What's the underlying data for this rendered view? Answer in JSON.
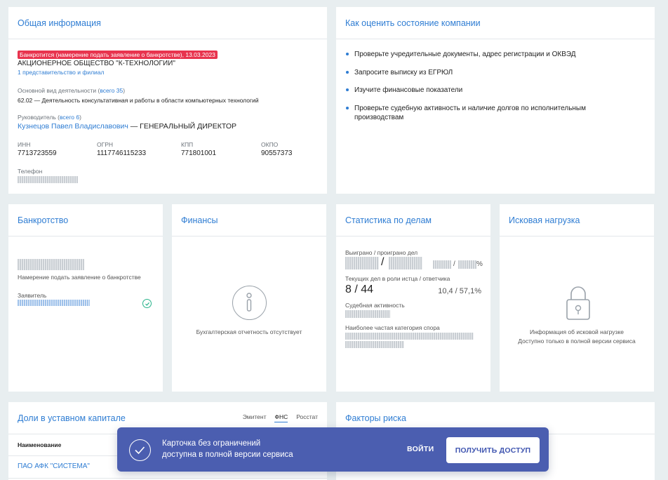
{
  "general": {
    "title": "Общая информация",
    "bankrupt_badge": "Банкротится (намерение подать заявление о банкротстве), 13.03.2023",
    "company_name": "АКЦИОНЕРНОЕ ОБЩЕСТВО \"К-ТЕХНОЛОГИИ\"",
    "branches_link": "1 представительство и филиал",
    "activity_label": "Основной вид деятельности (",
    "activity_count": "всего 35",
    "activity_close": ")",
    "activity_value": "62.02 — Деятельность консультативная и работы в области компьютерных технологий",
    "director_label": "Руководитель (",
    "director_count": "всего 6",
    "director_close": ")",
    "director_name": "Кузнецов Павел Владиславович",
    "director_role": " — ГЕНЕРАЛЬНЫЙ ДИРЕКТОР",
    "inn_label": "ИНН",
    "inn": "7713723559",
    "ogrn_label": "ОГРН",
    "ogrn": "1117746115233",
    "kpp_label": "КПП",
    "kpp": "771801001",
    "okpo_label": "ОКПО",
    "okpo": "90557373",
    "phone_label": "Телефон"
  },
  "assess": {
    "title": "Как оценить состояние компании",
    "items": [
      "Проверьте учредительные документы, адрес регистрации и ОКВЭД",
      "Запросите выписку из ЕГРЮЛ",
      "Изучите финансовые показатели",
      "Проверьте судебную активность и наличие долгов по исполнительным производствам"
    ]
  },
  "bankruptcy": {
    "title": "Банкротство",
    "note": "Намерение подать заявление о банкротстве",
    "applicant_label": "Заявитель"
  },
  "finance": {
    "title": "Финансы",
    "empty": "Бухгалтерская отчетность отсутствует"
  },
  "stats": {
    "title": "Статистика по делам",
    "won_lost_label": "Выиграно / проиграно дел",
    "slash": "/",
    "percent": "%",
    "current_label": "Текущих дел в роли истца / ответчика",
    "current_value": "8 / 44",
    "current_ratio": "10,4 / 57,1%",
    "activity_label": "Судебная активность",
    "category_label": "Наиболее частая категория спора"
  },
  "claims": {
    "title": "Исковая нагрузка",
    "line1": "Информация об исковой нагрузке",
    "line2": "Доступно только в полной версии сервиса"
  },
  "shares": {
    "title": "Доли в уставном капитале",
    "tabs": [
      "Эмитент",
      "ФНС",
      "Росстат"
    ],
    "active_tab": "ФНС",
    "col_name": "Наименование",
    "row1": "ПАО АФК \"СИСТЕМА\""
  },
  "risk": {
    "title": "Факторы риска"
  },
  "banner": {
    "line1": "Карточка без ограничений",
    "line2": "доступна в полной версии сервиса",
    "login": "ВОЙТИ",
    "cta": "ПОЛУЧИТЬ ДОСТУП"
  },
  "colors": {
    "accent": "#2f7dd3",
    "badge": "#e8344e",
    "banner": "#4b5eb0",
    "success": "#27b38a"
  }
}
